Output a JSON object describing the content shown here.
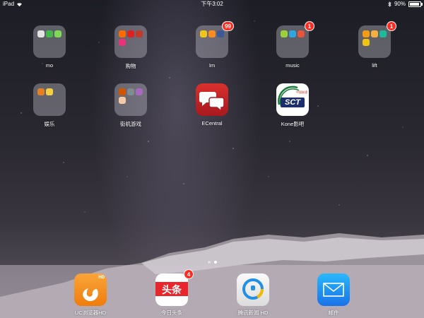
{
  "status_bar": {
    "device": "iPad",
    "time": "下午3:02",
    "battery_percent_text": "90%",
    "battery_level": 0.9,
    "icons": [
      "wifi-icon",
      "bluetooth-icon",
      "battery-icon"
    ]
  },
  "home": {
    "apps": [
      {
        "label": "mo",
        "type": "folder"
      },
      {
        "label": "购物",
        "type": "folder"
      },
      {
        "label": "Im",
        "type": "folder",
        "badge": "99"
      },
      {
        "label": "music",
        "type": "folder",
        "badge": "1"
      },
      {
        "label": "lift",
        "type": "folder",
        "badge": "1"
      },
      {
        "label": "娱乐",
        "type": "folder"
      },
      {
        "label": "街机游戏",
        "type": "folder"
      },
      {
        "label": "ECentral",
        "type": "app",
        "icon": "chat-bubbles-icon",
        "color": "#c4232a"
      },
      {
        "label": "Kone影吧",
        "type": "app",
        "icon": "sct-logo",
        "logo_text": "SCT",
        "logo_small_text": "中国联通"
      }
    ],
    "page_dots": {
      "count": 2,
      "active": 1
    }
  },
  "dock": {
    "apps": [
      {
        "label": "UC浏览器HD",
        "icon": "uc-browser-icon",
        "icon_tag": "HD",
        "color": "#f7941d"
      },
      {
        "label": "今日头条",
        "icon": "toutiao-icon",
        "icon_text": "头条",
        "badge": "4",
        "color": "#e8262c"
      },
      {
        "label": "腾讯新闻 HD",
        "icon": "tencent-news-icon",
        "color": "#1e90e6"
      },
      {
        "label": "邮件",
        "icon": "mail-icon",
        "color": "#1a8cf0"
      }
    ]
  }
}
